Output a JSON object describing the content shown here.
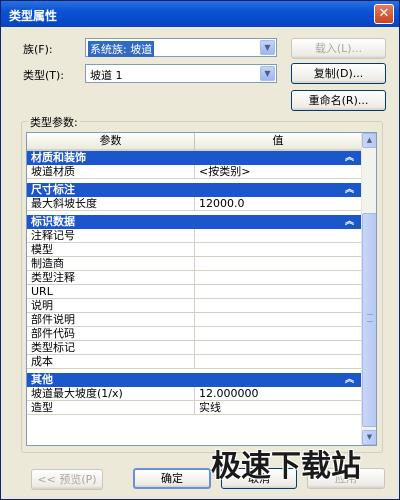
{
  "window": {
    "title": "类型属性",
    "close": "✕"
  },
  "family": {
    "label": "族(F):",
    "value": "系统族: 坡道"
  },
  "type": {
    "label": "类型(T):",
    "value": "坡道 1"
  },
  "buttons": {
    "load": "载入(L)...",
    "duplicate": "复制(D)...",
    "rename": "重命名(R)...",
    "preview": "<< 预览(P)",
    "ok": "确定",
    "cancel": "取消",
    "apply": "应用"
  },
  "params": {
    "group_label": "类型参数:",
    "headers": {
      "param": "参数",
      "value": "值"
    },
    "groups": [
      {
        "name": "材质和装饰",
        "rows": [
          {
            "param": "坡道材质",
            "value": "<按类别>"
          }
        ]
      },
      {
        "name": "尺寸标注",
        "rows": [
          {
            "param": "最大斜坡长度",
            "value": "12000.0"
          }
        ]
      },
      {
        "name": "标识数据",
        "rows": [
          {
            "param": "注释记号",
            "value": ""
          },
          {
            "param": "模型",
            "value": ""
          },
          {
            "param": "制造商",
            "value": ""
          },
          {
            "param": "类型注释",
            "value": ""
          },
          {
            "param": "URL",
            "value": ""
          },
          {
            "param": "说明",
            "value": ""
          },
          {
            "param": "部件说明",
            "value": ""
          },
          {
            "param": "部件代码",
            "value": ""
          },
          {
            "param": "类型标记",
            "value": ""
          },
          {
            "param": "成本",
            "value": ""
          }
        ]
      },
      {
        "name": "其他",
        "rows": [
          {
            "param": "坡道最大坡度(1/x)",
            "value": "12.000000"
          },
          {
            "param": "造型",
            "value": "实线"
          }
        ]
      }
    ]
  },
  "watermark": "极速下载站",
  "icons": {
    "collapse": "chevron-double-up-icon",
    "dropdown": "chevron-down-icon"
  }
}
